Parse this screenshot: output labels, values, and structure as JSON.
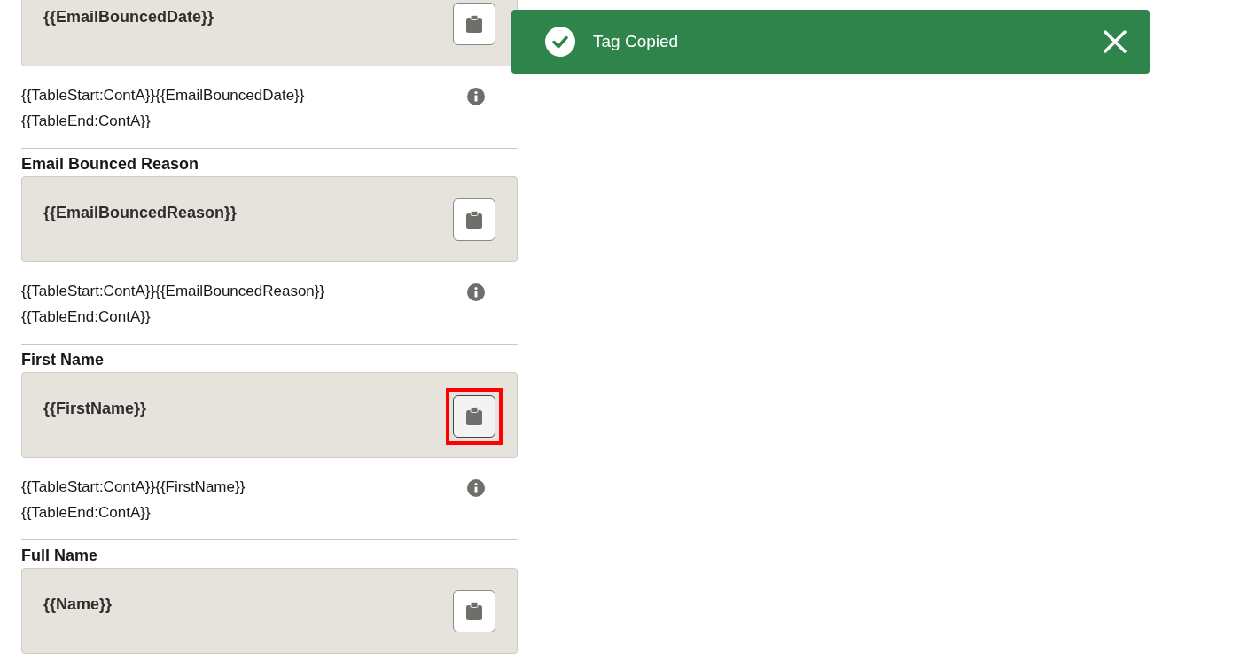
{
  "fields": [
    {
      "tag": "{{EmailBouncedDate}}",
      "copy_highlighted": false,
      "usage_lines": [
        "{{TableStart:ContA}}{{EmailBouncedDate}}",
        "{{TableEnd:ContA}}"
      ]
    },
    {
      "label": "Email Bounced Reason",
      "tag": "{{EmailBouncedReason}}",
      "copy_highlighted": false,
      "usage_lines": [
        "{{TableStart:ContA}}{{EmailBouncedReason}}",
        "{{TableEnd:ContA}}"
      ]
    },
    {
      "label": "First Name",
      "tag": "{{FirstName}}",
      "copy_highlighted": true,
      "usage_lines": [
        "{{TableStart:ContA}}{{FirstName}}",
        "{{TableEnd:ContA}}"
      ]
    },
    {
      "label": "Full Name",
      "tag": "{{Name}}",
      "copy_highlighted": false
    }
  ],
  "toast": {
    "message": "Tag Copied"
  }
}
